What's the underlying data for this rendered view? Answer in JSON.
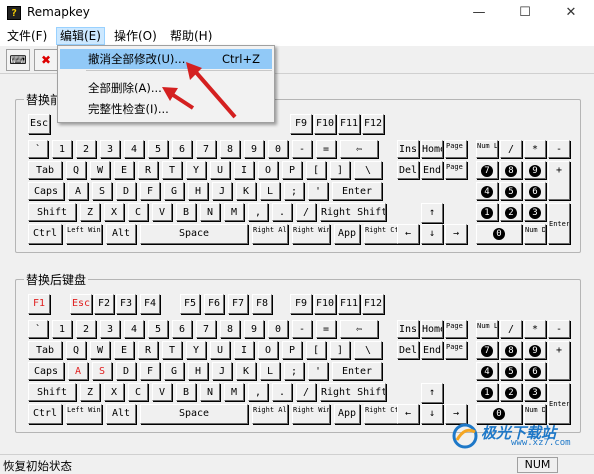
{
  "window": {
    "title": "Remapkey",
    "icon_text": "?",
    "minimize": "—",
    "maximize": "☐",
    "close": "✕"
  },
  "menubar": [
    {
      "label": "文件(F)",
      "name": "menu-file"
    },
    {
      "label": "编辑(E)",
      "name": "menu-edit"
    },
    {
      "label": "操作(O)",
      "name": "menu-operate"
    },
    {
      "label": "帮助(H)",
      "name": "menu-help"
    }
  ],
  "toolbar": [
    {
      "icon": "keyboard-icon",
      "glyph": "⌨"
    },
    {
      "icon": "close-red-icon",
      "glyph": "✖"
    }
  ],
  "edit_menu": {
    "items": [
      {
        "label": "撤消全部修改(U)...",
        "shortcut": "Ctrl+Z",
        "highlighted": true
      },
      {
        "label": "全部删除(A)...",
        "shortcut": ""
      },
      {
        "label": "完整性检查(I)...",
        "shortcut": ""
      }
    ]
  },
  "upper_panel": {
    "label": "替换前键盘"
  },
  "lower_panel": {
    "label": "替换后键盘"
  },
  "keyboard": {
    "fn_row": [
      {
        "id": "esc",
        "label": "Esc"
      },
      {
        "id": "f1",
        "label": "F1"
      },
      {
        "id": "f2",
        "label": "F2"
      },
      {
        "id": "f3",
        "label": "F3"
      },
      {
        "id": "f4",
        "label": "F4"
      },
      {
        "id": "f5",
        "label": "F5"
      },
      {
        "id": "f6",
        "label": "F6"
      },
      {
        "id": "f7",
        "label": "F7"
      },
      {
        "id": "f8",
        "label": "F8"
      },
      {
        "id": "f9",
        "label": "F9"
      },
      {
        "id": "f10",
        "label": "F10"
      },
      {
        "id": "f11",
        "label": "F11"
      },
      {
        "id": "f12",
        "label": "F12"
      }
    ],
    "num_row": [
      "`",
      "1",
      "2",
      "3",
      "4",
      "5",
      "6",
      "7",
      "8",
      "9",
      "0",
      "-",
      "=",
      "⇦"
    ],
    "tab_row": [
      "Tab",
      "Q",
      "W",
      "E",
      "R",
      "T",
      "Y",
      "U",
      "I",
      "O",
      "P",
      "[",
      "]",
      "\\"
    ],
    "caps_row": [
      "Caps",
      "A",
      "S",
      "D",
      "F",
      "G",
      "H",
      "J",
      "K",
      "L",
      ";",
      "'",
      "Enter"
    ],
    "shift_row": [
      "Shift",
      "Z",
      "X",
      "C",
      "V",
      "B",
      "N",
      "M",
      ",",
      ".",
      "/",
      "Right Shift"
    ],
    "ctrl_row": [
      "Ctrl",
      "Left Windows",
      "Alt",
      "Space",
      "Right Alt",
      "Right Windows",
      "App",
      "Right Ctrl"
    ],
    "nav": [
      "Ins",
      "Home",
      "Page Up",
      "Del",
      "End",
      "Page Down"
    ],
    "arrows": [
      "↑",
      "←",
      "↓",
      "→"
    ],
    "numpad": [
      "Num Lock",
      "/",
      "*",
      "-",
      "7",
      "8",
      "9",
      "+",
      "4",
      "5",
      "6",
      "1",
      "2",
      "3",
      "Enter",
      "0",
      "Num Del"
    ]
  },
  "lower_remapped": [
    "F1",
    "Esc",
    "A",
    "S"
  ],
  "status": {
    "text": "恢复初始状态",
    "num": "NUM"
  },
  "watermark": {
    "text": "极光下载站",
    "url": "www.xz7.com"
  },
  "colors": {
    "highlight": "#91c9f7",
    "red_key": "#e02020",
    "arrow": "#d42020"
  }
}
